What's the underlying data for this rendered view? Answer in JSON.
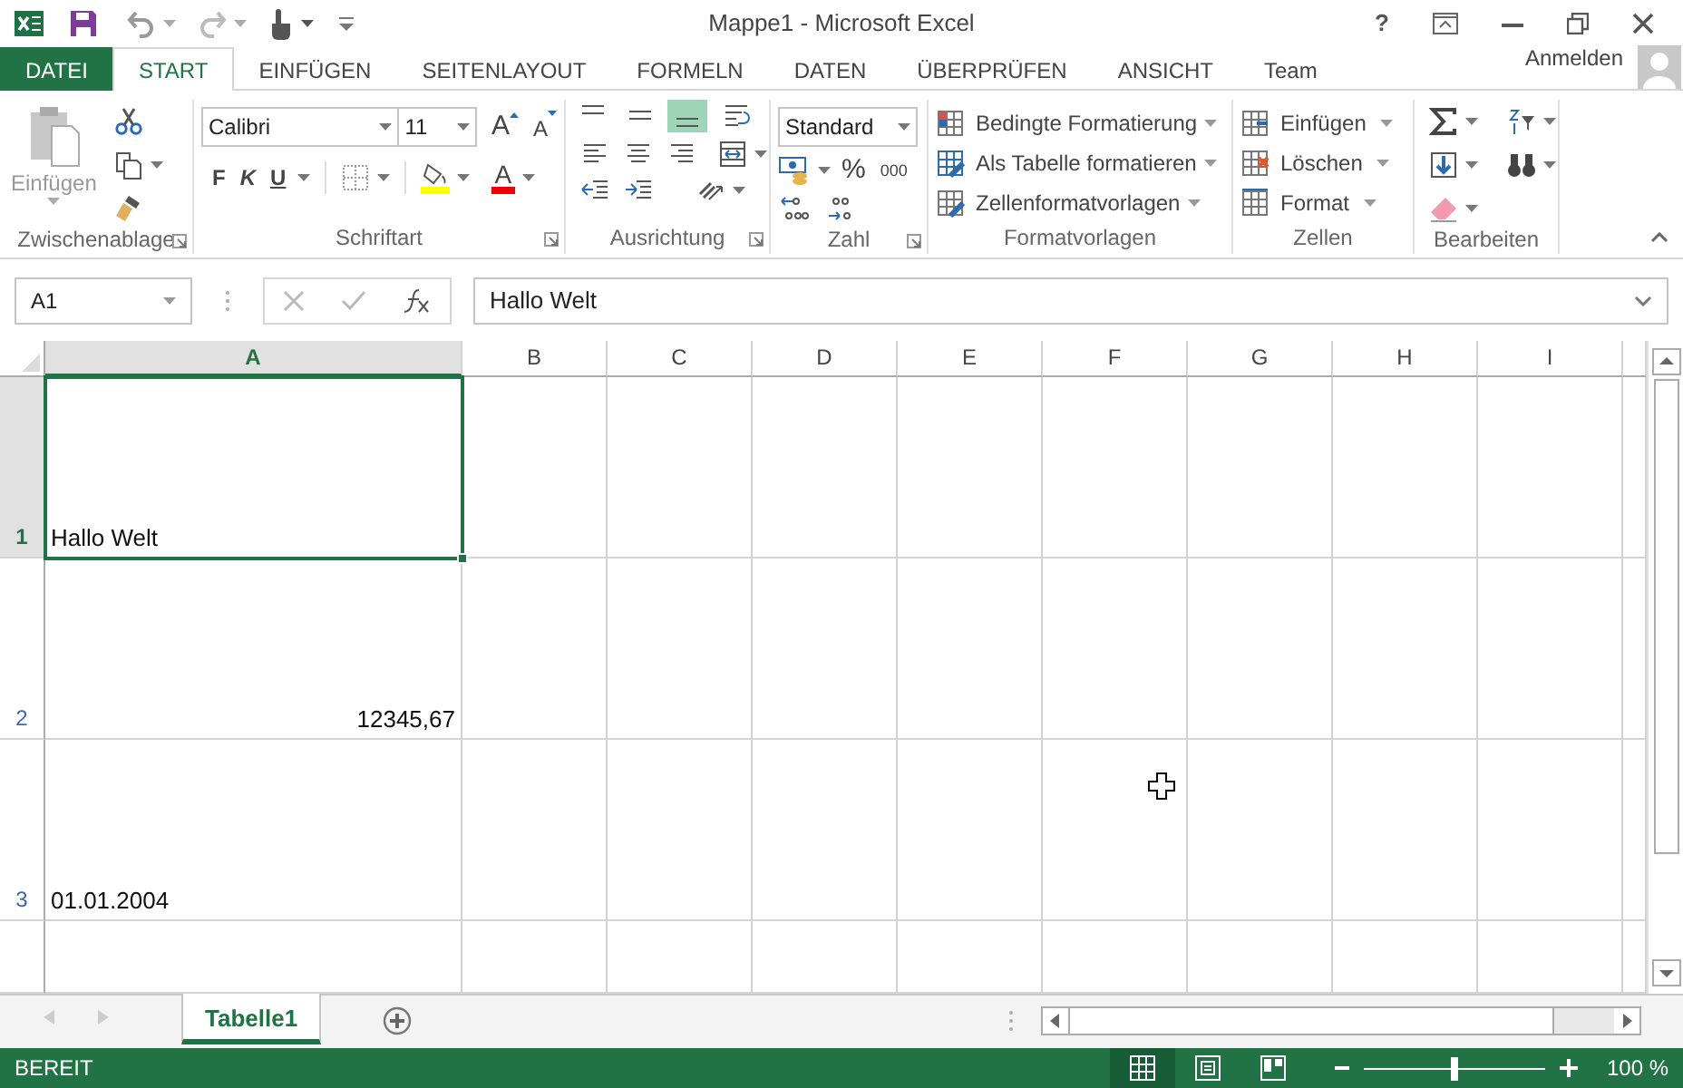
{
  "window": {
    "title": "Mappe1 - Microsoft Excel",
    "help": "?"
  },
  "tabs": [
    {
      "label": "DATEI",
      "kind": "file",
      "selected": false
    },
    {
      "label": "START",
      "kind": "tab",
      "selected": true
    },
    {
      "label": "EINFÜGEN",
      "kind": "tab",
      "selected": false
    },
    {
      "label": "SEITENLAYOUT",
      "kind": "tab",
      "selected": false
    },
    {
      "label": "FORMELN",
      "kind": "tab",
      "selected": false
    },
    {
      "label": "DATEN",
      "kind": "tab",
      "selected": false
    },
    {
      "label": "ÜBERPRÜFEN",
      "kind": "tab",
      "selected": false
    },
    {
      "label": "ANSICHT",
      "kind": "tab",
      "selected": false
    },
    {
      "label": "Team",
      "kind": "tab",
      "selected": false
    }
  ],
  "account": {
    "label": "Anmelden"
  },
  "ribbon": {
    "clipboard": {
      "label": "Zwischenablage",
      "paste": {
        "label": "Einfügen",
        "disabled": true
      }
    },
    "font": {
      "label": "Schriftart",
      "name": "Calibri",
      "size": "11",
      "grow": "A",
      "shrink": "A",
      "bold": "F",
      "italic": "K",
      "underline": "U",
      "font_color": "A"
    },
    "alignment": {
      "label": "Ausrichtung",
      "vertical": [
        {
          "kind": "top",
          "selected": false
        },
        {
          "kind": "middle",
          "selected": false
        },
        {
          "kind": "bottom",
          "selected": true
        }
      ]
    },
    "number": {
      "label": "Zahl",
      "format": "Standard",
      "percent": "%",
      "thousands": "000"
    },
    "styles": {
      "label": "Formatvorlagen",
      "items": [
        {
          "kind": "conditional",
          "label": "Bedingte Formatierung"
        },
        {
          "kind": "table",
          "label": "Als Tabelle formatieren"
        },
        {
          "kind": "cellstyles",
          "label": "Zellenformatvorlagen"
        }
      ]
    },
    "cells": {
      "label": "Zellen",
      "items": [
        {
          "kind": "insert",
          "label": "Einfügen"
        },
        {
          "kind": "delete",
          "label": "Löschen"
        },
        {
          "kind": "format",
          "label": "Format"
        }
      ]
    },
    "editing": {
      "label": "Bearbeiten"
    }
  },
  "formula_bar": {
    "name_box": "A1",
    "formula": "Hallo Welt"
  },
  "columns": [
    {
      "label": "A",
      "selected": true
    },
    {
      "label": "B",
      "selected": false
    },
    {
      "label": "C",
      "selected": false
    },
    {
      "label": "D",
      "selected": false
    },
    {
      "label": "E",
      "selected": false
    },
    {
      "label": "F",
      "selected": false
    },
    {
      "label": "G",
      "selected": false
    },
    {
      "label": "H",
      "selected": false
    },
    {
      "label": "I",
      "selected": false
    }
  ],
  "rows": [
    {
      "label": "1",
      "selected": true,
      "cells": [
        {
          "text": "Hallo Welt",
          "kind": "text",
          "selected": true
        }
      ]
    },
    {
      "label": "2",
      "selected": false,
      "cells": [
        {
          "text": "12345,67",
          "kind": "number",
          "selected": false
        }
      ]
    },
    {
      "label": "3",
      "selected": false,
      "cells": [
        {
          "text": "01.01.2004",
          "kind": "text",
          "selected": false
        }
      ]
    }
  ],
  "sheets": [
    {
      "label": "Tabelle1",
      "selected": true
    }
  ],
  "status_bar": {
    "text": "BEREIT",
    "views": [
      {
        "kind": "normal",
        "selected": true
      },
      {
        "kind": "layout",
        "selected": false
      },
      {
        "kind": "pagebreak",
        "selected": false
      }
    ],
    "zoom": {
      "level": 0.5,
      "reading": "100 %"
    }
  }
}
